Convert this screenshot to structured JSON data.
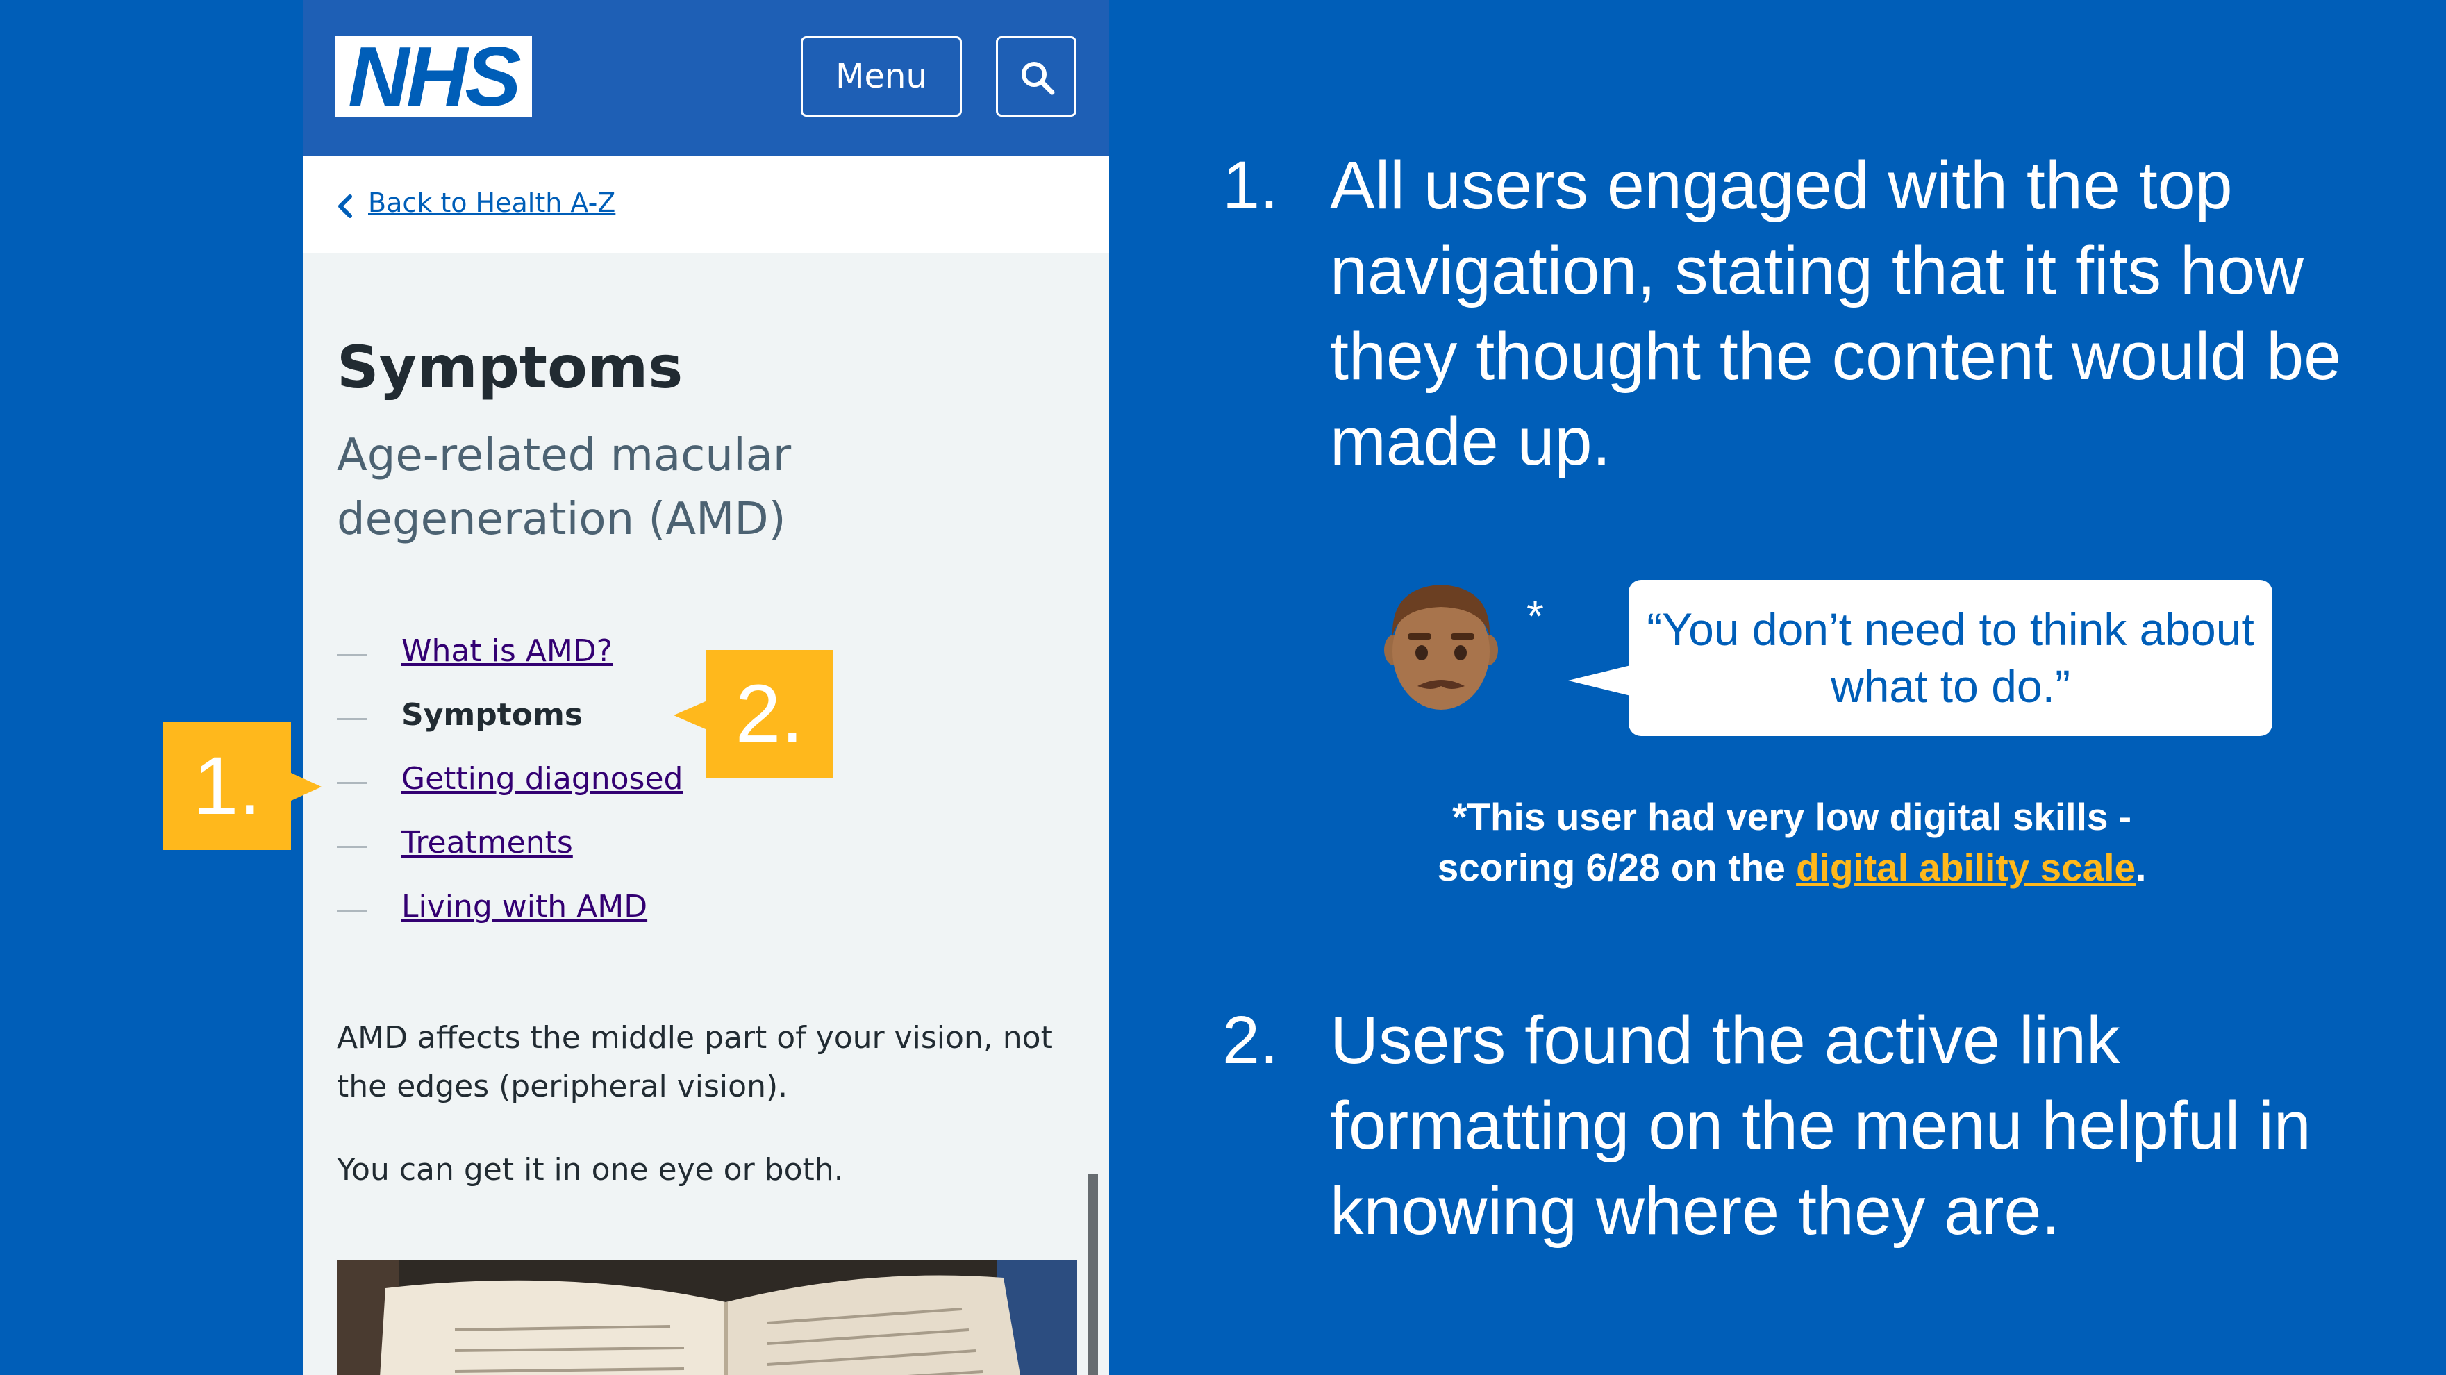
{
  "phone": {
    "header": {
      "logo_text": "NHS",
      "menu_label": "Menu"
    },
    "breadcrumb": {
      "back_link": "Back to Health A-Z"
    },
    "page_title": "Symptoms",
    "page_subtitle": "Age-related macular degeneration (AMD)",
    "contents": [
      {
        "label": "What is AMD?",
        "current": false
      },
      {
        "label": "Symptoms",
        "current": true
      },
      {
        "label": "Getting diagnosed",
        "current": false
      },
      {
        "label": "Treatments",
        "current": false
      },
      {
        "label": "Living with AMD",
        "current": false
      }
    ],
    "paragraphs": [
      "AMD affects the middle part of your vision, not the edges (peripheral vision).",
      "You can get it in one eye or both."
    ]
  },
  "markers": {
    "one": "1.",
    "two": "2."
  },
  "findings": [
    {
      "number": "1.",
      "text": "All users engaged with the top navigation, stating that it fits how they thought the content would be made up."
    },
    {
      "number": "2.",
      "text": "Users found the active link formatting on the menu helpful in knowing where they are."
    }
  ],
  "quote": {
    "asterisk": "*",
    "text": "“You don’t need to think about what to do.”"
  },
  "footnote": {
    "line1": "*This user had very low digital skills -",
    "line2_prefix": "scoring 6/28 on the ",
    "link_text": "digital ability scale",
    "line2_suffix": "."
  },
  "colors": {
    "background": "#005EB8",
    "phone_header": "#1E5FB5",
    "marker": "#FFB81C",
    "link": "#330072",
    "text": "#212B32"
  },
  "icons": [
    "search-icon",
    "chevron-left-icon",
    "man-emoji-icon"
  ]
}
